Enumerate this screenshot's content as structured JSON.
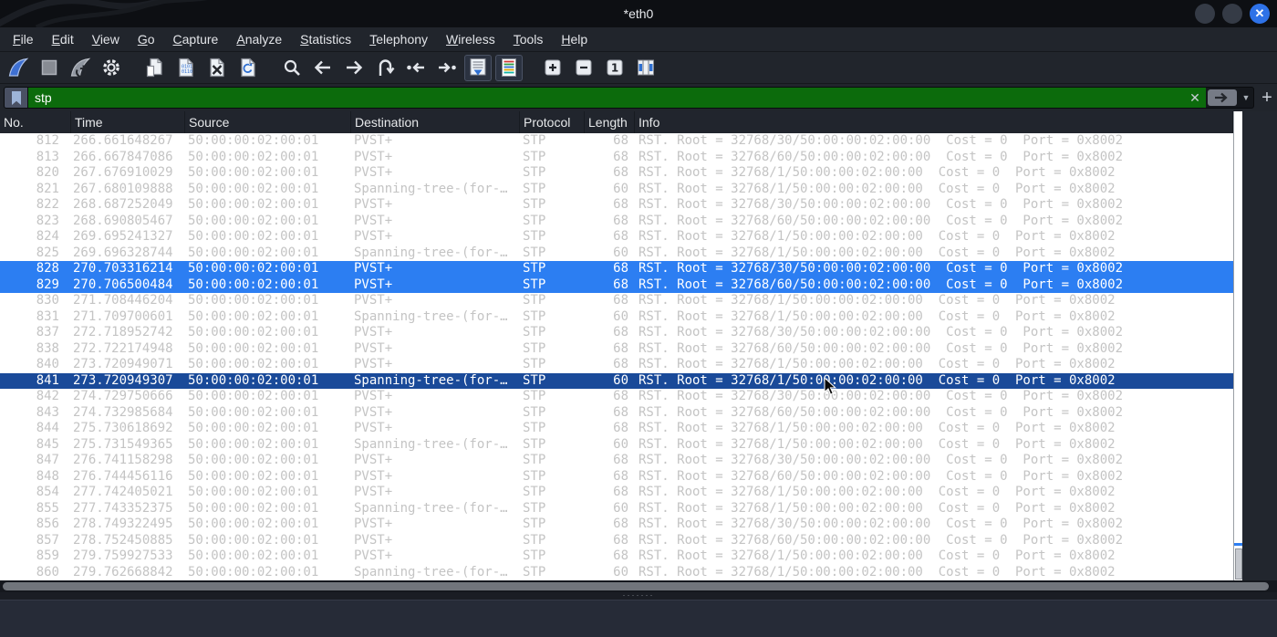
{
  "window": {
    "title": "*eth0"
  },
  "menu": {
    "items": [
      "File",
      "Edit",
      "View",
      "Go",
      "Capture",
      "Analyze",
      "Statistics",
      "Telephony",
      "Wireless",
      "Tools",
      "Help"
    ]
  },
  "toolbar": {
    "buttons": [
      {
        "name": "start-capture",
        "icon": "shark-fin-blue",
        "active": false,
        "group": false
      },
      {
        "name": "stop-capture",
        "icon": "stop-square",
        "active": false,
        "group": false
      },
      {
        "name": "restart-capture",
        "icon": "shark-fin-restart",
        "active": false,
        "group": false
      },
      {
        "name": "capture-options",
        "icon": "gear",
        "active": false,
        "group": false
      },
      {
        "name": "open-file",
        "icon": "doc-open",
        "active": false,
        "group": true
      },
      {
        "name": "save-file",
        "icon": "doc-save",
        "active": false,
        "group": false
      },
      {
        "name": "close-file",
        "icon": "doc-close",
        "active": false,
        "group": false
      },
      {
        "name": "reload-file",
        "icon": "doc-reload",
        "active": false,
        "group": false
      },
      {
        "name": "find-packet",
        "icon": "magnifier",
        "active": false,
        "group": true
      },
      {
        "name": "go-back",
        "icon": "arrow-left",
        "active": false,
        "group": false
      },
      {
        "name": "go-forward",
        "icon": "arrow-right",
        "active": false,
        "group": false
      },
      {
        "name": "go-to-packet",
        "icon": "uturn-arrow",
        "active": false,
        "group": false
      },
      {
        "name": "go-first-packet",
        "icon": "arrow-left-dot",
        "active": false,
        "group": false
      },
      {
        "name": "go-last-packet",
        "icon": "arrow-right-dot",
        "active": false,
        "group": false
      },
      {
        "name": "auto-scroll",
        "icon": "doc-down-arrow",
        "active": true,
        "group": false
      },
      {
        "name": "colorize",
        "icon": "doc-color-lines",
        "active": true,
        "group": false
      },
      {
        "name": "zoom-in",
        "icon": "square-plus",
        "active": false,
        "group": true
      },
      {
        "name": "zoom-out",
        "icon": "square-minus",
        "active": false,
        "group": false
      },
      {
        "name": "zoom-original",
        "icon": "square-one",
        "active": false,
        "group": false
      },
      {
        "name": "resize-columns",
        "icon": "table-resize",
        "active": false,
        "group": false
      }
    ]
  },
  "filter": {
    "value": "stp",
    "add_button_label": "+"
  },
  "packet_list": {
    "columns": [
      "No.",
      "Time",
      "Source",
      "Destination",
      "Protocol",
      "Length",
      "Info"
    ],
    "rows": [
      {
        "no": "812",
        "time": "266.661648267",
        "source": "50:00:00:02:00:01",
        "destination": "PVST+",
        "protocol": "STP",
        "length": "68",
        "info": "RST. Root = 32768/30/50:00:00:02:00:00  Cost = 0  Port = 0x8002",
        "state": "normal"
      },
      {
        "no": "813",
        "time": "266.667847086",
        "source": "50:00:00:02:00:01",
        "destination": "PVST+",
        "protocol": "STP",
        "length": "68",
        "info": "RST. Root = 32768/60/50:00:00:02:00:00  Cost = 0  Port = 0x8002",
        "state": "normal"
      },
      {
        "no": "820",
        "time": "267.676910029",
        "source": "50:00:00:02:00:01",
        "destination": "PVST+",
        "protocol": "STP",
        "length": "68",
        "info": "RST. Root = 32768/1/50:00:00:02:00:00  Cost = 0  Port = 0x8002",
        "state": "normal"
      },
      {
        "no": "821",
        "time": "267.680109888",
        "source": "50:00:00:02:00:01",
        "destination": "Spanning-tree-(for-…",
        "protocol": "STP",
        "length": "60",
        "info": "RST. Root = 32768/1/50:00:00:02:00:00  Cost = 0  Port = 0x8002",
        "state": "normal"
      },
      {
        "no": "822",
        "time": "268.687252049",
        "source": "50:00:00:02:00:01",
        "destination": "PVST+",
        "protocol": "STP",
        "length": "68",
        "info": "RST. Root = 32768/30/50:00:00:02:00:00  Cost = 0  Port = 0x8002",
        "state": "normal"
      },
      {
        "no": "823",
        "time": "268.690805467",
        "source": "50:00:00:02:00:01",
        "destination": "PVST+",
        "protocol": "STP",
        "length": "68",
        "info": "RST. Root = 32768/60/50:00:00:02:00:00  Cost = 0  Port = 0x8002",
        "state": "normal"
      },
      {
        "no": "824",
        "time": "269.695241327",
        "source": "50:00:00:02:00:01",
        "destination": "PVST+",
        "protocol": "STP",
        "length": "68",
        "info": "RST. Root = 32768/1/50:00:00:02:00:00  Cost = 0  Port = 0x8002",
        "state": "normal"
      },
      {
        "no": "825",
        "time": "269.696328744",
        "source": "50:00:00:02:00:01",
        "destination": "Spanning-tree-(for-…",
        "protocol": "STP",
        "length": "60",
        "info": "RST. Root = 32768/1/50:00:00:02:00:00  Cost = 0  Port = 0x8002",
        "state": "normal"
      },
      {
        "no": "828",
        "time": "270.703316214",
        "source": "50:00:00:02:00:01",
        "destination": "PVST+",
        "protocol": "STP",
        "length": "68",
        "info": "RST. Root = 32768/30/50:00:00:02:00:00  Cost = 0  Port = 0x8002",
        "state": "selected"
      },
      {
        "no": "829",
        "time": "270.706500484",
        "source": "50:00:00:02:00:01",
        "destination": "PVST+",
        "protocol": "STP",
        "length": "68",
        "info": "RST. Root = 32768/60/50:00:00:02:00:00  Cost = 0  Port = 0x8002",
        "state": "selected"
      },
      {
        "no": "830",
        "time": "271.708446204",
        "source": "50:00:00:02:00:01",
        "destination": "PVST+",
        "protocol": "STP",
        "length": "68",
        "info": "RST. Root = 32768/1/50:00:00:02:00:00  Cost = 0  Port = 0x8002",
        "state": "normal"
      },
      {
        "no": "831",
        "time": "271.709700601",
        "source": "50:00:00:02:00:01",
        "destination": "Spanning-tree-(for-…",
        "protocol": "STP",
        "length": "60",
        "info": "RST. Root = 32768/1/50:00:00:02:00:00  Cost = 0  Port = 0x8002",
        "state": "normal"
      },
      {
        "no": "837",
        "time": "272.718952742",
        "source": "50:00:00:02:00:01",
        "destination": "PVST+",
        "protocol": "STP",
        "length": "68",
        "info": "RST. Root = 32768/30/50:00:00:02:00:00  Cost = 0  Port = 0x8002",
        "state": "normal"
      },
      {
        "no": "838",
        "time": "272.722174948",
        "source": "50:00:00:02:00:01",
        "destination": "PVST+",
        "protocol": "STP",
        "length": "68",
        "info": "RST. Root = 32768/60/50:00:00:02:00:00  Cost = 0  Port = 0x8002",
        "state": "normal"
      },
      {
        "no": "840",
        "time": "273.720949071",
        "source": "50:00:00:02:00:01",
        "destination": "PVST+",
        "protocol": "STP",
        "length": "68",
        "info": "RST. Root = 32768/1/50:00:00:02:00:00  Cost = 0  Port = 0x8002",
        "state": "normal"
      },
      {
        "no": "841",
        "time": "273.720949307",
        "source": "50:00:00:02:00:01",
        "destination": "Spanning-tree-(for-…",
        "protocol": "STP",
        "length": "60",
        "info": "RST. Root = 32768/1/50:00:00:02:00:00  Cost = 0  Port = 0x8002",
        "state": "current"
      },
      {
        "no": "842",
        "time": "274.729750666",
        "source": "50:00:00:02:00:01",
        "destination": "PVST+",
        "protocol": "STP",
        "length": "68",
        "info": "RST. Root = 32768/30/50:00:00:02:00:00  Cost = 0  Port = 0x8002",
        "state": "normal"
      },
      {
        "no": "843",
        "time": "274.732985684",
        "source": "50:00:00:02:00:01",
        "destination": "PVST+",
        "protocol": "STP",
        "length": "68",
        "info": "RST. Root = 32768/60/50:00:00:02:00:00  Cost = 0  Port = 0x8002",
        "state": "normal"
      },
      {
        "no": "844",
        "time": "275.730618692",
        "source": "50:00:00:02:00:01",
        "destination": "PVST+",
        "protocol": "STP",
        "length": "68",
        "info": "RST. Root = 32768/1/50:00:00:02:00:00  Cost = 0  Port = 0x8002",
        "state": "normal"
      },
      {
        "no": "845",
        "time": "275.731549365",
        "source": "50:00:00:02:00:01",
        "destination": "Spanning-tree-(for-…",
        "protocol": "STP",
        "length": "60",
        "info": "RST. Root = 32768/1/50:00:00:02:00:00  Cost = 0  Port = 0x8002",
        "state": "normal"
      },
      {
        "no": "847",
        "time": "276.741158298",
        "source": "50:00:00:02:00:01",
        "destination": "PVST+",
        "protocol": "STP",
        "length": "68",
        "info": "RST. Root = 32768/30/50:00:00:02:00:00  Cost = 0  Port = 0x8002",
        "state": "normal"
      },
      {
        "no": "848",
        "time": "276.744456116",
        "source": "50:00:00:02:00:01",
        "destination": "PVST+",
        "protocol": "STP",
        "length": "68",
        "info": "RST. Root = 32768/60/50:00:00:02:00:00  Cost = 0  Port = 0x8002",
        "state": "normal"
      },
      {
        "no": "854",
        "time": "277.742405021",
        "source": "50:00:00:02:00:01",
        "destination": "PVST+",
        "protocol": "STP",
        "length": "68",
        "info": "RST. Root = 32768/1/50:00:00:02:00:00  Cost = 0  Port = 0x8002",
        "state": "normal"
      },
      {
        "no": "855",
        "time": "277.743352375",
        "source": "50:00:00:02:00:01",
        "destination": "Spanning-tree-(for-…",
        "protocol": "STP",
        "length": "60",
        "info": "RST. Root = 32768/1/50:00:00:02:00:00  Cost = 0  Port = 0x8002",
        "state": "normal"
      },
      {
        "no": "856",
        "time": "278.749322495",
        "source": "50:00:00:02:00:01",
        "destination": "PVST+",
        "protocol": "STP",
        "length": "68",
        "info": "RST. Root = 32768/30/50:00:00:02:00:00  Cost = 0  Port = 0x8002",
        "state": "normal"
      },
      {
        "no": "857",
        "time": "278.752450885",
        "source": "50:00:00:02:00:01",
        "destination": "PVST+",
        "protocol": "STP",
        "length": "68",
        "info": "RST. Root = 32768/60/50:00:00:02:00:00  Cost = 0  Port = 0x8002",
        "state": "normal"
      },
      {
        "no": "859",
        "time": "279.759927533",
        "source": "50:00:00:02:00:01",
        "destination": "PVST+",
        "protocol": "STP",
        "length": "68",
        "info": "RST. Root = 32768/1/50:00:00:02:00:00  Cost = 0  Port = 0x8002",
        "state": "normal"
      },
      {
        "no": "860",
        "time": "279.762668842",
        "source": "50:00:00:02:00:01",
        "destination": "Spanning-tree-(for-…",
        "protocol": "STP",
        "length": "60",
        "info": "RST. Root = 32768/1/50:00:00:02:00:00  Cost = 0  Port = 0x8002",
        "state": "normal"
      }
    ]
  },
  "colors": {
    "filter_valid_green": "#0c6b0c",
    "selected_row_blue": "#2c7ef2",
    "current_row_navy": "#1a4a99",
    "normal_row_text": "#c4c4c4",
    "close_button_blue": "#2e72e8",
    "titlebar_bg": "#0d0f13",
    "chrome_bg": "#21252c"
  }
}
